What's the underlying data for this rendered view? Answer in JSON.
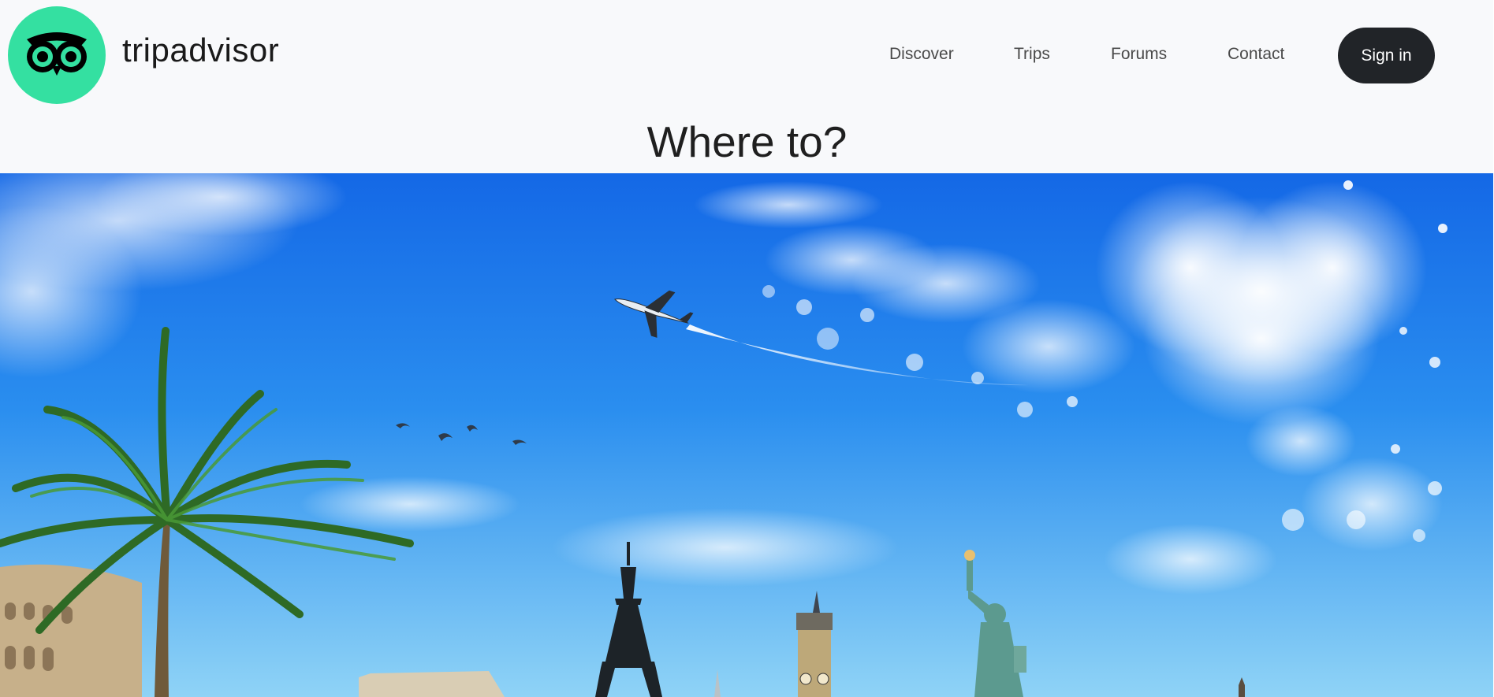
{
  "brand": {
    "name": "tripadvisor"
  },
  "nav": {
    "links": [
      "Discover",
      "Trips",
      "Forums",
      "Contact"
    ],
    "signin_label": "Sign in"
  },
  "hero": {
    "title": "Where to?"
  },
  "colors": {
    "logo_green": "#34e0a1",
    "signin_bg": "#212428",
    "sky_top": "#1f78ea",
    "sky_bottom": "#8fd0f5"
  },
  "icons": {
    "logo": "owl-logo-icon"
  }
}
